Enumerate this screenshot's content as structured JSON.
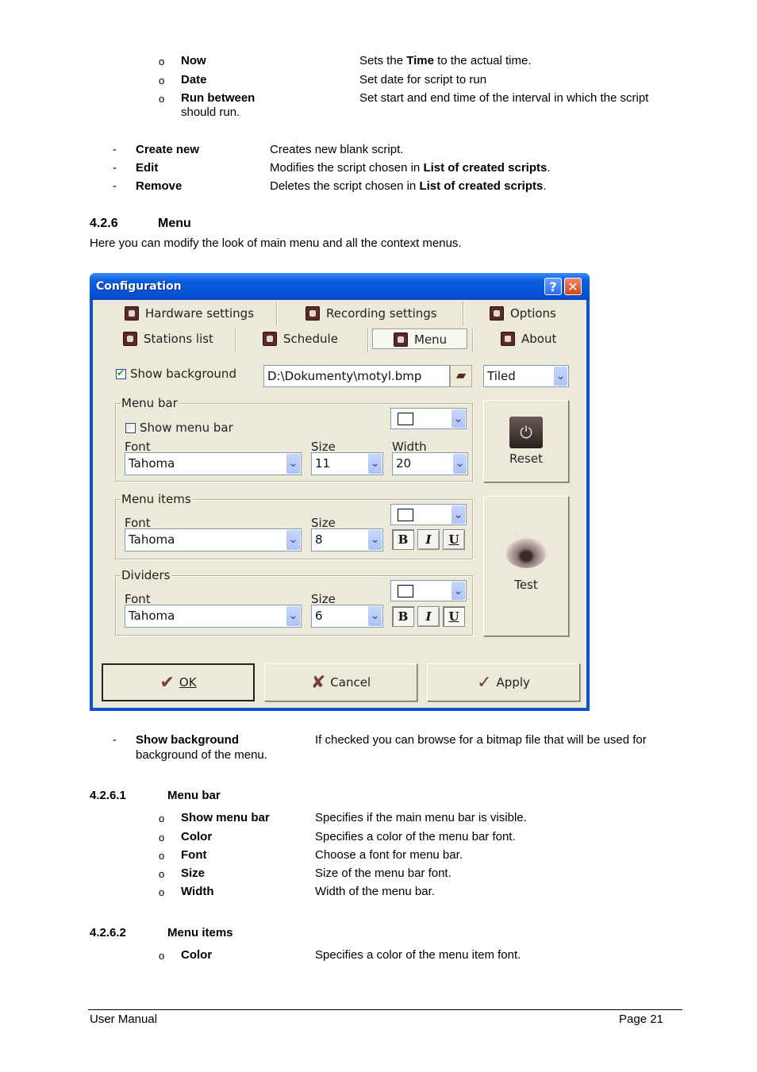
{
  "doc": {
    "sub_bullets_top": [
      {
        "term": "Now",
        "desc_parts": [
          {
            "text": "Sets the ",
            "bold": false
          },
          {
            "text": "Time",
            "bold": true
          },
          {
            "text": " to the actual time.",
            "bold": false
          }
        ]
      },
      {
        "term": "Date",
        "desc": "Set date for script to run"
      },
      {
        "term": "Run between",
        "desc": "Set start and end time of the interval in which the script",
        "continuation": "should run."
      }
    ],
    "dash_items": [
      {
        "term": "Create new",
        "desc": "Creates new blank script."
      },
      {
        "term": "Edit",
        "desc_pre": "Modifies the script chosen in ",
        "desc_bold": "List of created scripts",
        "desc_post": "."
      },
      {
        "term": "Remove",
        "desc_pre": "Deletes the script chosen in ",
        "desc_bold": "List of created scripts",
        "desc_post": "."
      }
    ],
    "section": {
      "number": "4.2.6",
      "title": "Menu",
      "intro": "Here you can modify the look of main menu and all the context menus."
    },
    "show_background_item": {
      "term": "Show background",
      "desc": "If checked you can browse for a bitmap file that will be used for",
      "continuation": "background of the menu."
    },
    "sub1": {
      "number": "4.2.6.1",
      "title": "Menu bar",
      "items": [
        {
          "term": "Show menu bar",
          "desc": "Specifies if the main menu bar is visible."
        },
        {
          "term": "Color",
          "desc": "Specifies a color of the menu bar font."
        },
        {
          "term": "Font",
          "desc": "Choose a font for menu bar."
        },
        {
          "term": "Size",
          "desc": "Size of the menu bar font."
        },
        {
          "term": "Width",
          "desc": "Width of the menu bar."
        }
      ]
    },
    "sub2": {
      "number": "4.2.6.2",
      "title": "Menu items",
      "items": [
        {
          "term": "Color",
          "desc": "Specifies a color of the menu item font."
        }
      ]
    },
    "footer": {
      "left": "User Manual",
      "right": "Page 21"
    },
    "bullet_circle": "o",
    "bullet_dash": "-"
  },
  "dialog": {
    "title": "Configuration",
    "help_label": "?",
    "close_label": "✕",
    "tabs": [
      {
        "label": "Hardware settings",
        "icon": "hardware-icon"
      },
      {
        "label": "Recording settings",
        "icon": "record-icon"
      },
      {
        "label": "Options",
        "icon": "monitor-icon"
      },
      {
        "label": "Stations list",
        "icon": "waveform-icon"
      },
      {
        "label": "Schedule",
        "icon": "clock-icon"
      },
      {
        "label": "Menu",
        "icon": "menu-icon",
        "active": true
      },
      {
        "label": "About",
        "icon": "about-icon"
      }
    ],
    "show_background": {
      "label": "Show background",
      "checked": true
    },
    "background_path": "D:\\Dokumenty\\motyl.bmp",
    "background_mode": "Tiled",
    "menu_bar": {
      "title": "Menu bar",
      "show_menu_bar": {
        "label": "Show menu bar",
        "checked": false
      },
      "font_label": "Font",
      "font": "Tahoma",
      "size_label": "Size",
      "size": "11",
      "width_label": "Width",
      "width": "20",
      "color": "#ffffff"
    },
    "menu_items": {
      "title": "Menu items",
      "font_label": "Font",
      "font": "Tahoma",
      "size_label": "Size",
      "size": "8",
      "color": "#ffffff",
      "bold_label": "B",
      "italic_label": "I",
      "underline_label": "U",
      "bold": true,
      "italic": false,
      "underline": false
    },
    "dividers": {
      "title": "Dividers",
      "font_label": "Font",
      "font": "Tahoma",
      "size_label": "Size",
      "size": "6",
      "color": "#ffffff",
      "bold_label": "B",
      "italic_label": "I",
      "underline_label": "U",
      "bold": true,
      "italic": false,
      "underline": true
    },
    "reset_label": "Reset",
    "test_label": "Test",
    "ok_label": "OK",
    "cancel_label": "Cancel",
    "apply_label": "Apply"
  }
}
